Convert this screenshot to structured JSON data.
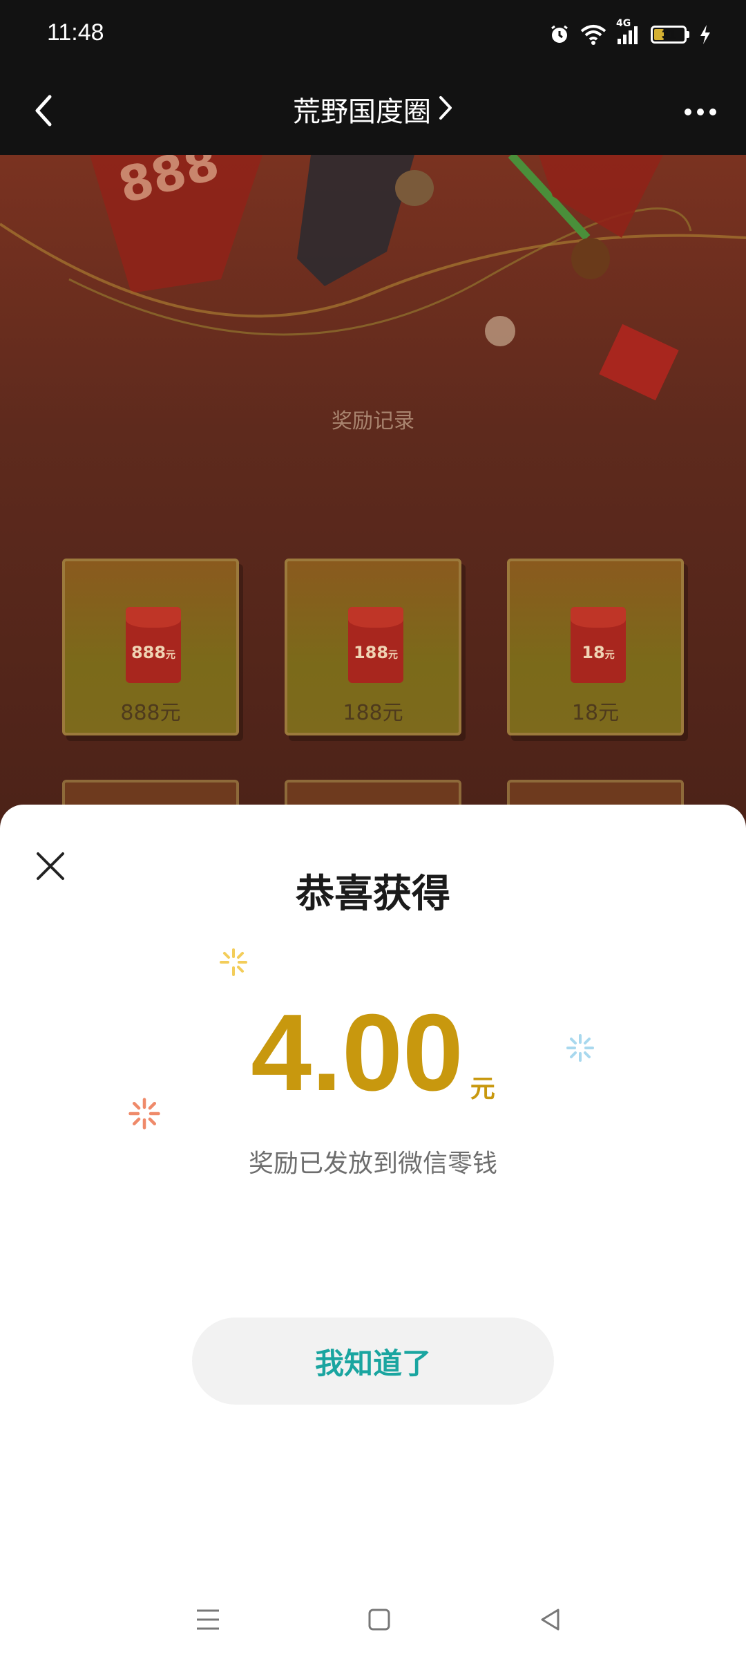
{
  "status_bar": {
    "time": "11:48",
    "icons": [
      "alarm-icon",
      "wifi-icon",
      "signal-4g-icon",
      "battery-icon",
      "charging-icon"
    ],
    "network_label": "4G",
    "battery_level": "31"
  },
  "nav": {
    "title": "荒野国度圈",
    "back_icon": "chevron-left-icon",
    "title_icon": "chevron-right-icon",
    "more_icon": "more-dots-icon"
  },
  "background": {
    "section_title": "奖励记录",
    "cards": [
      {
        "envelope_value": "888",
        "envelope_unit": "元",
        "label": "888元"
      },
      {
        "envelope_value": "188",
        "envelope_unit": "元",
        "label": "188元"
      },
      {
        "envelope_value": "18",
        "envelope_unit": "元",
        "label": "18元"
      }
    ]
  },
  "sheet": {
    "title": "恭喜获得",
    "amount": "4.00",
    "amount_unit": "元",
    "subtitle": "奖励已发放到微信零钱",
    "button_label": "我知道了",
    "close_icon": "close-icon"
  },
  "colors": {
    "accent_gold": "#c8980e",
    "button_text": "#1aa5a0",
    "sparkle_yellow": "#f3cd5a",
    "sparkle_blue": "#a8d8ee",
    "sparkle_red": "#ef8a6a"
  },
  "system_nav": {
    "icons": [
      "menu-icon",
      "home-square-icon",
      "back-triangle-icon"
    ]
  }
}
